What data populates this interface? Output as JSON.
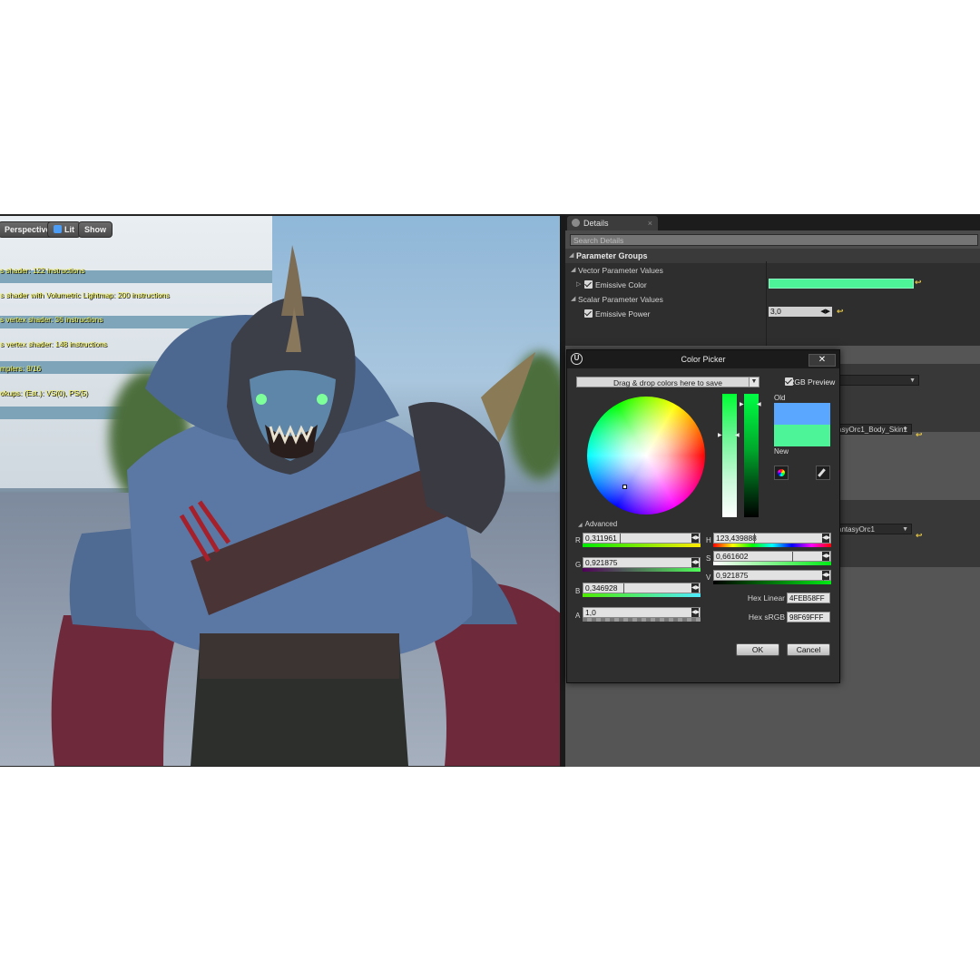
{
  "viewport": {
    "buttons": {
      "perspective": "Perspective",
      "lit": "Lit",
      "show": "Show"
    },
    "stats": [
      "s shader: 122 instructions",
      "s shader with Volumetric Lightmap: 200 instructions",
      "s vertex shader: 36 instructions",
      "s vertex shader: 148 instructions",
      "mplers: 8/16",
      "okups: (Est.): VS(0), PS(5)"
    ]
  },
  "details": {
    "tab_label": "Details",
    "tab_close": "×",
    "search_placeholder": "Search Details",
    "parameter_groups": "Parameter Groups",
    "vector_group": "Vector Parameter Values",
    "emissive_color_label": "Emissive Color",
    "scalar_group": "Scalar Parameter Values",
    "emissive_power_label": "Emissive Power",
    "emissive_power_value": "3,0",
    "combo_texture_1": "asyOrc1_Body_Skin1",
    "combo_texture_2": "antasyOrc1"
  },
  "color_picker": {
    "title": "Color Picker",
    "close": "✕",
    "dropzone": "Drag & drop colors here to save",
    "srgb_preview": "sRGB Preview",
    "old_label": "Old",
    "new_label": "New",
    "advanced_label": "Advanced",
    "channels": {
      "r": {
        "label": "R",
        "value": "0,311961"
      },
      "g": {
        "label": "G",
        "value": "0,921875"
      },
      "b": {
        "label": "B",
        "value": "0,346928"
      },
      "a": {
        "label": "A",
        "value": "1,0"
      },
      "h": {
        "label": "H",
        "value": "123,439888"
      },
      "s": {
        "label": "S",
        "value": "0,661602"
      },
      "v": {
        "label": "V",
        "value": "0,921875"
      }
    },
    "hex_linear_label": "Hex Linear",
    "hex_linear_value": "4FEB58FF",
    "hex_srgb_label": "Hex sRGB",
    "hex_srgb_value": "98F69FFF",
    "ok_label": "OK",
    "cancel_label": "Cancel"
  },
  "colors": {
    "old_color": "#5aa7ff",
    "new_color": "#4ef598",
    "emissive_color": "#4ef598",
    "reset_arrow": "#e8c844"
  }
}
